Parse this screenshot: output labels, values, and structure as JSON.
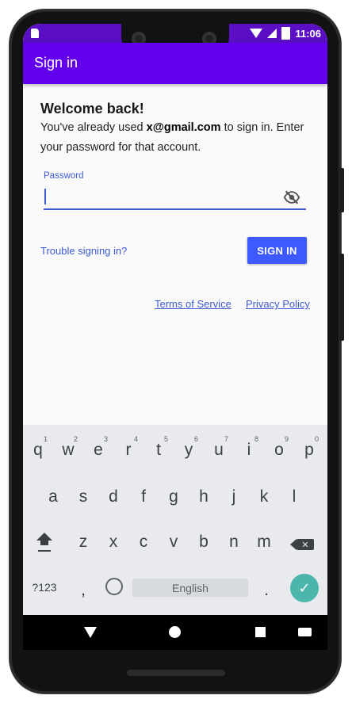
{
  "status_bar": {
    "time": "11:06"
  },
  "app_bar": {
    "title": "Sign in"
  },
  "content": {
    "welcome_heading": "Welcome back!",
    "message_prefix": "You've already used ",
    "email": "x@gmail.com",
    "message_suffix": " to sign in. Enter your password for that account.",
    "password_label": "Password",
    "password_value": "",
    "trouble_link": "Trouble signing in?",
    "sign_in_button": "SIGN IN",
    "terms_link": "Terms of Service",
    "privacy_link": "Privacy Policy"
  },
  "keyboard": {
    "row1": [
      {
        "key": "q",
        "hint": "1"
      },
      {
        "key": "w",
        "hint": "2"
      },
      {
        "key": "e",
        "hint": "3"
      },
      {
        "key": "r",
        "hint": "4"
      },
      {
        "key": "t",
        "hint": "5"
      },
      {
        "key": "y",
        "hint": "6"
      },
      {
        "key": "u",
        "hint": "7"
      },
      {
        "key": "i",
        "hint": "8"
      },
      {
        "key": "o",
        "hint": "9"
      },
      {
        "key": "p",
        "hint": "0"
      }
    ],
    "row2": [
      "a",
      "s",
      "d",
      "f",
      "g",
      "h",
      "j",
      "k",
      "l"
    ],
    "row3": [
      "z",
      "x",
      "c",
      "v",
      "b",
      "n",
      "m"
    ],
    "symbols_key": "?123",
    "comma_key": ",",
    "space_label": "English",
    "period_key": ".",
    "enter_icon": "check-icon"
  },
  "colors": {
    "accent": "#6200ee",
    "status_bar": "#5a0fc4",
    "link": "#3f5ad6",
    "button": "#3d5afe",
    "enter": "#4db6ac"
  }
}
